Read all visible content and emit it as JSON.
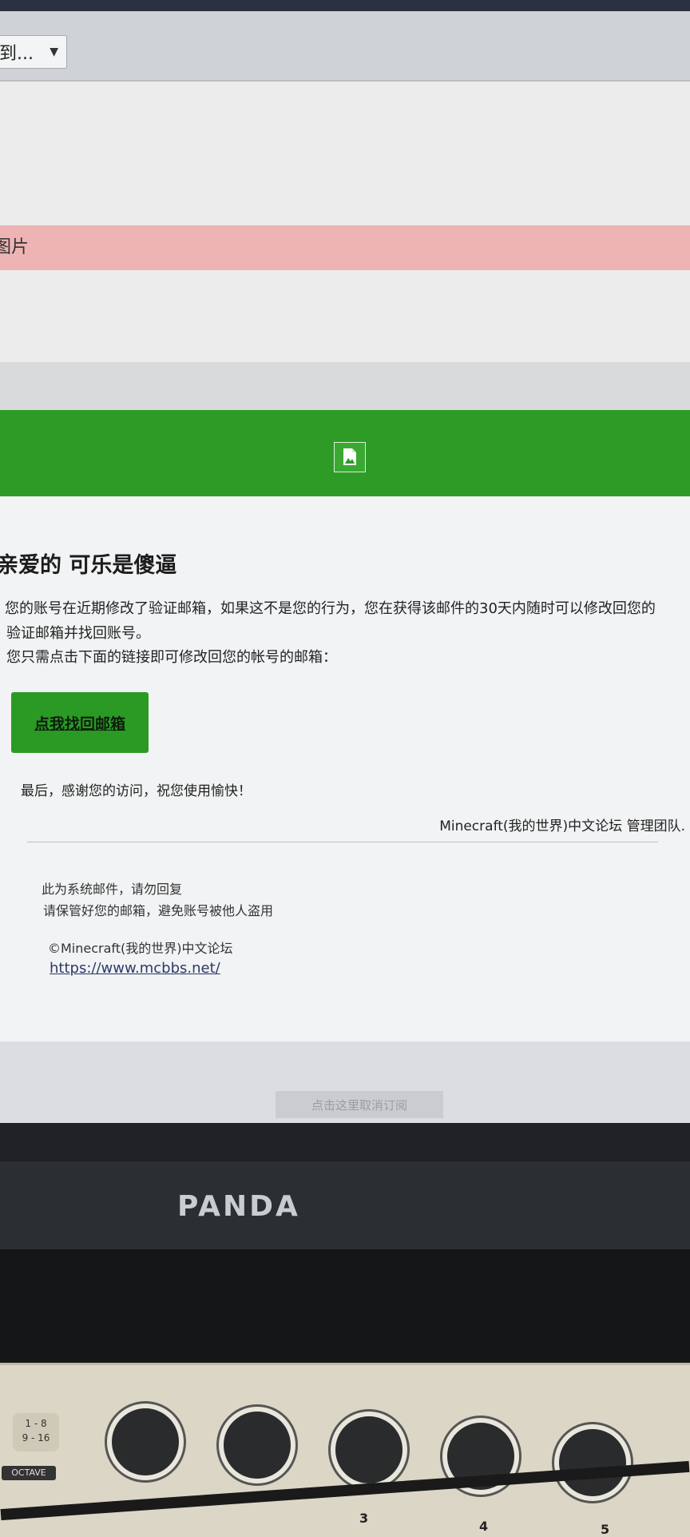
{
  "browser": {
    "dropdown_label": "到...",
    "alert_text": "图片"
  },
  "email": {
    "greeting": "亲爱的 可乐是傻逼",
    "paragraph_line1": "您的账号在近期修改了验证邮箱，如果这不是您的行为，您在获得该邮件的30天内随时可以修改回您的",
    "paragraph_line2": "验证邮箱并找回账号。",
    "paragraph_line3": "您只需点击下面的链接即可修改回您的帐号的邮箱：",
    "action_button": "点我找回邮箱",
    "thanks": "最后，感谢您的访问，祝您使用愉快！",
    "signature": "Minecraft(我的世界)中文论坛 管理团队.",
    "footer_line1": "此为系统邮件，请勿回复",
    "footer_line2": "请保管好您的邮箱，避免账号被他人盗用",
    "copyright": "©Minecraft(我的世界)中文论坛",
    "site_link": "https://www.mcbbs.net/",
    "unsubscribe": "点击这里取消订阅"
  },
  "monitor": {
    "brand": "PANDA"
  },
  "keyboard": {
    "range_tag_line1": "1 - 8",
    "range_tag_line2": "9 - 16",
    "octave_label": "OCTAVE",
    "knob_numbers": [
      "3",
      "4",
      "5"
    ]
  },
  "colors": {
    "header_green": "#2e9b27",
    "button_green": "#2b9a24",
    "alert_pink": "#eeb4b3"
  }
}
